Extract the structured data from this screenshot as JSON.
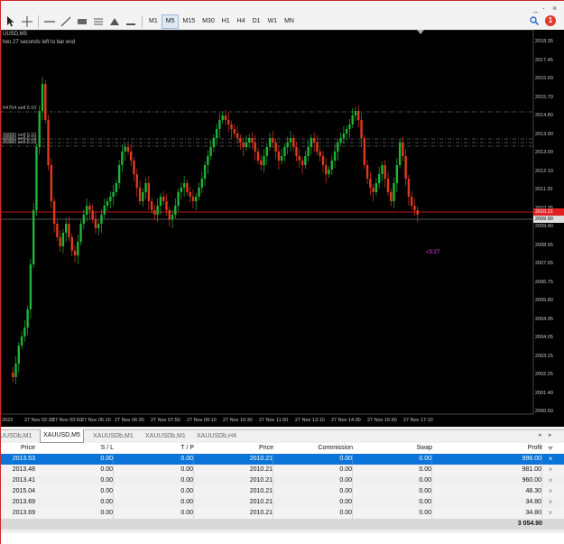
{
  "toolbar": {
    "timeframes": [
      "M1",
      "M5",
      "M15",
      "M30",
      "H1",
      "H4",
      "D1",
      "W1",
      "MN"
    ],
    "active_timeframe": "M5",
    "alert_count": "1",
    "window_controls": [
      "_",
      "·",
      "×"
    ]
  },
  "chart": {
    "title": "UUSD,M5",
    "note": "two 27 seconds left to bar end",
    "timer": "<3:27",
    "current_price_red": "2010.21",
    "current_price_white": "2009.90",
    "levels": [
      {
        "label": "04754 sell 0.10"
      },
      {
        "label": "99880 sell 0.10"
      },
      {
        "label": "98880 sell 0.10"
      },
      {
        "label": "95880 sell 0.10"
      }
    ],
    "y_labels": [
      "2018.35",
      "2017.45",
      "2016.60",
      "2015.70",
      "2014.80",
      "2013.90",
      "2013.00",
      "2012.10",
      "2011.20",
      "2010.35",
      "2009.40",
      "2008.55",
      "2007.65",
      "2006.75",
      "2005.80",
      "2004.95",
      "2004.05",
      "2003.15",
      "2002.25",
      "2001.40",
      "2000.50"
    ],
    "x_labels": [
      "2023",
      "27 Nov 02:30",
      "27 Nov 03:50",
      "27 Nov 05:10",
      "27 Nov 06:30",
      "27 Nov 07:50",
      "27 Nov 09:10",
      "27 Nov 10:30",
      "27 Nov 11:50",
      "27 Nov 13:10",
      "27 Nov 14:30",
      "27 Nov 15:50",
      "27 Nov 17:10"
    ],
    "colors": {
      "bull": "#1db535",
      "bear": "#e03a1e",
      "bg": "#000000",
      "price_line": "#ff2020"
    }
  },
  "tabs": {
    "items": [
      "UUSDb,M1",
      "XAUUSD,M5",
      "XAUUSDb,M1",
      "XAUUSDb,M1",
      "XAUUSDb,H4"
    ],
    "active": "XAUUSD,M5"
  },
  "trade_table": {
    "headers": [
      "Price",
      "S / L",
      "T / P",
      "Price",
      "Commission",
      "Swap",
      "Profit"
    ],
    "rows": [
      [
        "2013.53",
        "0.00",
        "0.00",
        "2010.21",
        "0.00",
        "0.00",
        "996.00"
      ],
      [
        "2013.48",
        "0.00",
        "0.00",
        "2010.21",
        "0.00",
        "0.00",
        "981.00"
      ],
      [
        "2013.41",
        "0.00",
        "0.00",
        "2010.21",
        "0.00",
        "0.00",
        "960.00"
      ],
      [
        "2015.04",
        "0.00",
        "0.00",
        "2010.21",
        "0.00",
        "0.00",
        "48.30"
      ],
      [
        "2013.69",
        "0.00",
        "0.00",
        "2010.21",
        "0.00",
        "0.00",
        "34.80"
      ],
      [
        "2013.69",
        "0.00",
        "0.00",
        "2010.21",
        "0.00",
        "0.00",
        "34.80"
      ]
    ],
    "total": "3 054.90",
    "close_icon": "×"
  }
}
